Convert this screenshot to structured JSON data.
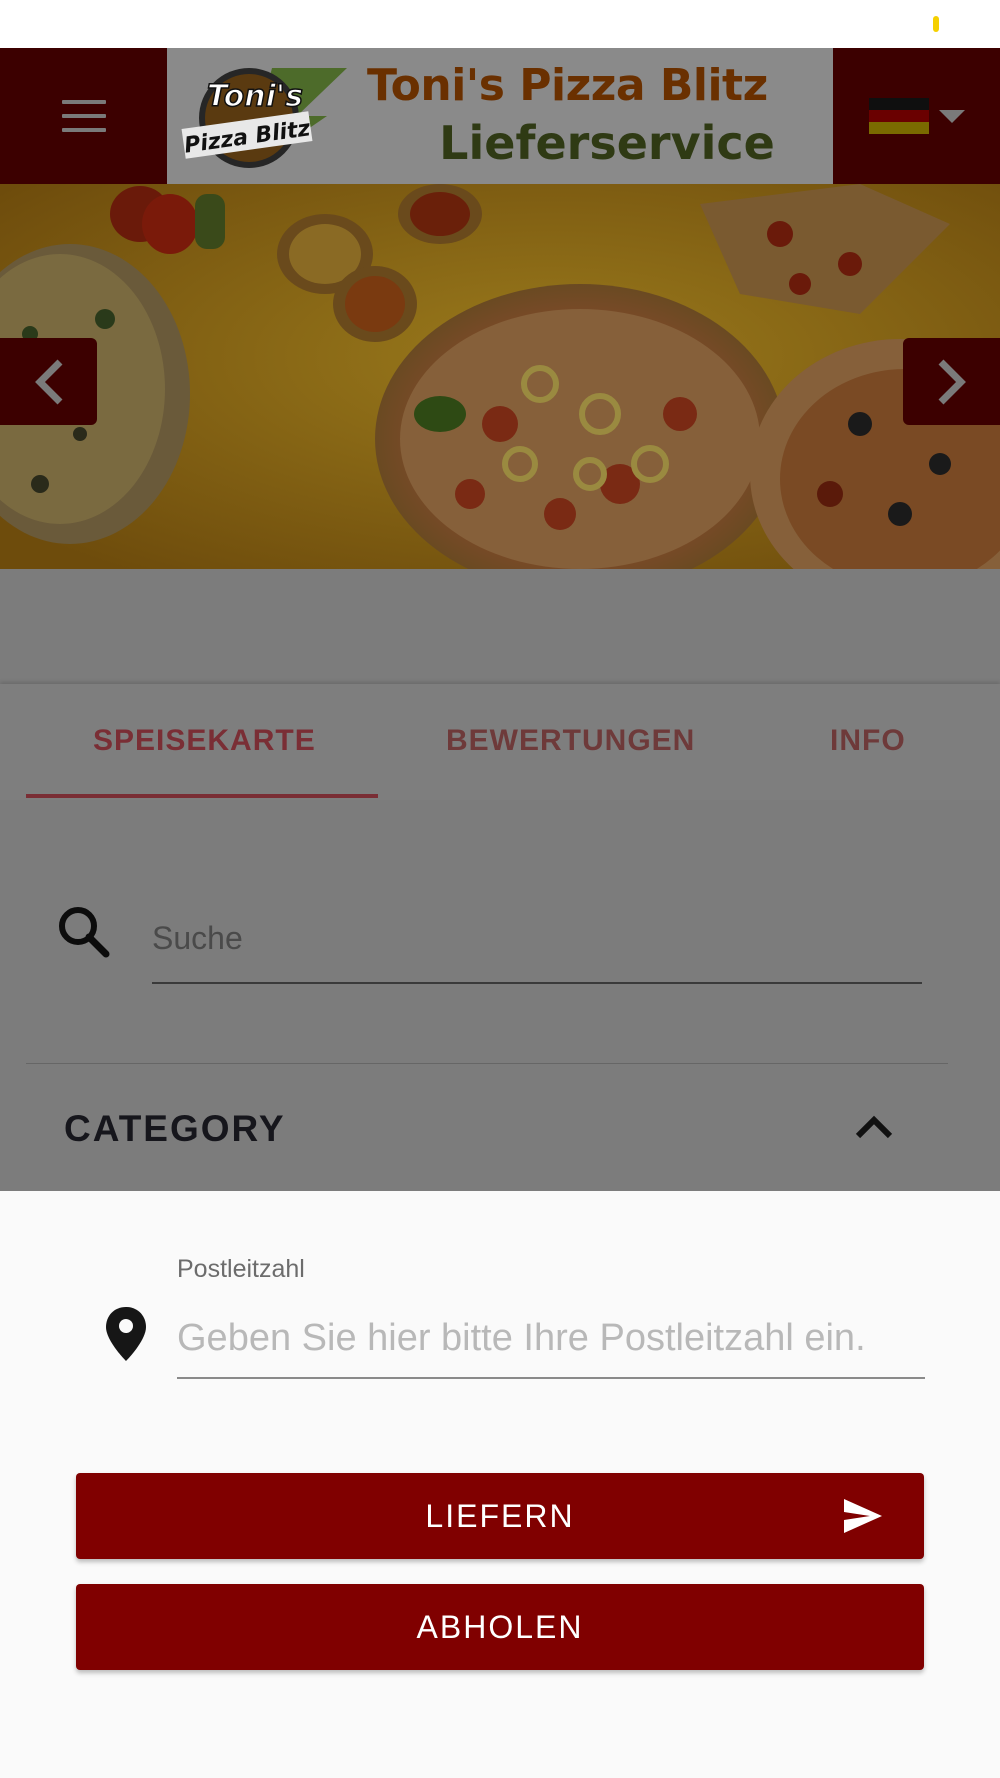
{
  "header": {
    "logo_badge_top": "Toni's",
    "logo_badge_bottom": "Pizza Blitz",
    "title": "Toni's Pizza Blitz",
    "subtitle": "Lieferservice"
  },
  "tabs": [
    {
      "label": "SPEISEKARTE",
      "active": true
    },
    {
      "label": "BEWERTUNGEN",
      "active": false
    },
    {
      "label": "INFO",
      "active": false
    }
  ],
  "search": {
    "placeholder": "Suche",
    "value": ""
  },
  "category": {
    "title": "CATEGORY"
  },
  "delivery_sheet": {
    "postcode_label": "Postleitzahl",
    "postcode_placeholder": "Geben Sie hier bitte Ihre Postleitzahl ein.",
    "postcode_value": "",
    "deliver_label": "LIEFERN",
    "pickup_label": "ABHOLEN"
  },
  "colors": {
    "brand": "#800000",
    "topbar_dimmed": "#3c0000",
    "overlay_grey": "#7c7c7c",
    "sheet_bg": "#fafafa"
  },
  "icons": {
    "menu": "hamburger-icon",
    "language": "german-flag-icon",
    "prev": "chevron-left-icon",
    "next": "chevron-right-icon",
    "search": "search-icon",
    "collapse": "chevron-up-icon",
    "location": "map-pin-icon",
    "send": "send-icon"
  }
}
